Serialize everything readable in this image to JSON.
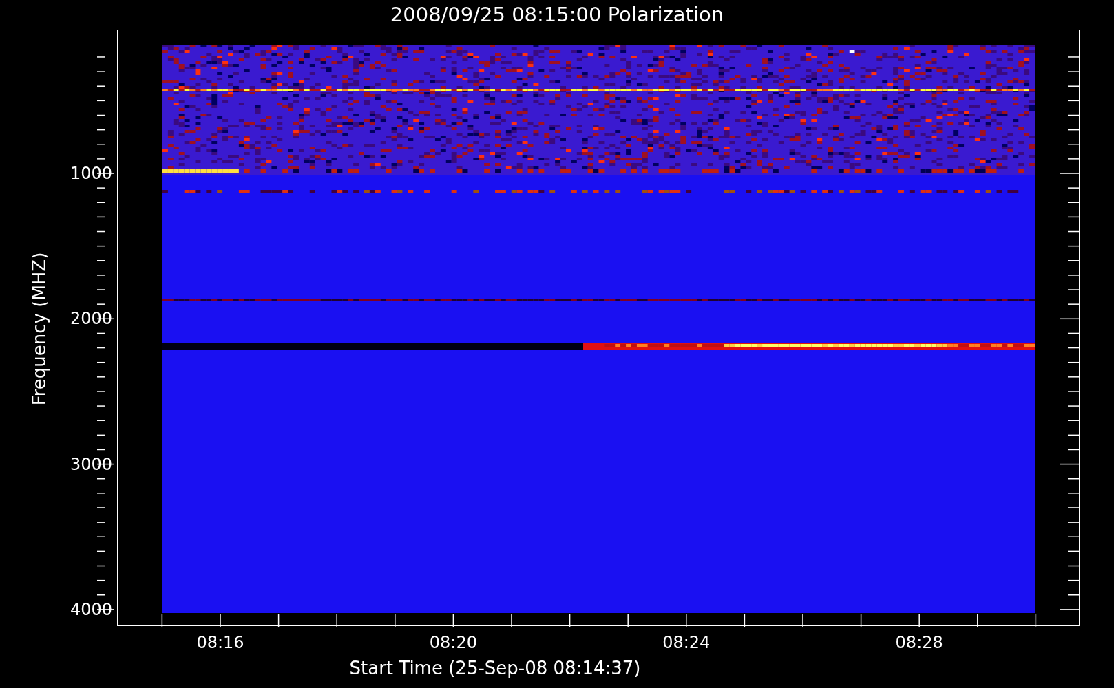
{
  "title": "2008/09/25 08:15:00 Polarization",
  "y_axis": {
    "label": "Frequency (MHZ)",
    "ticks": [
      "1000",
      "2000",
      "3000",
      "4000"
    ]
  },
  "x_axis": {
    "label": "Start Time (25-Sep-08 08:14:37)",
    "ticks": [
      "08:16",
      "08:20",
      "08:24",
      "08:28"
    ]
  }
}
